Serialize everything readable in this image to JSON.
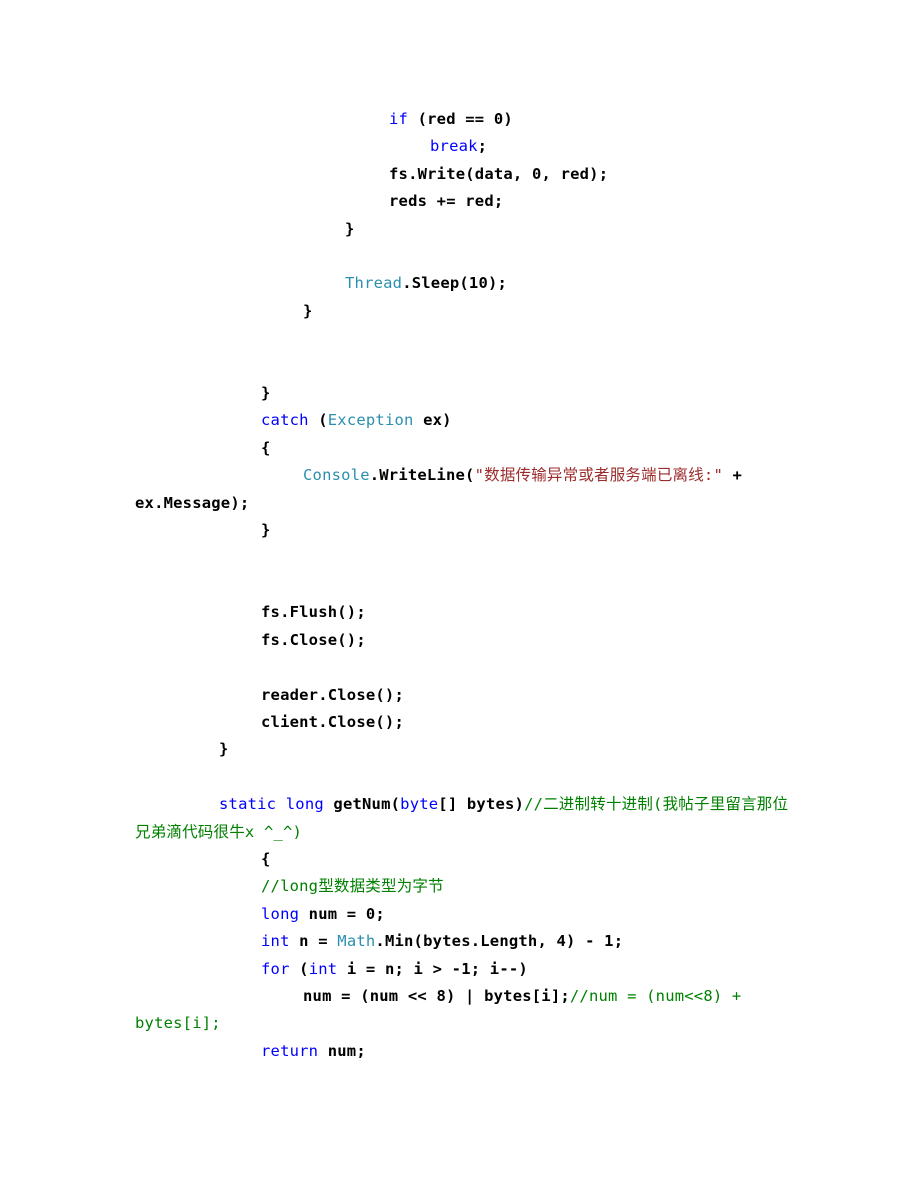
{
  "document": {
    "kind": "code-listing-page",
    "language": "C#",
    "page_background": "#ffffff",
    "colors": {
      "keyword": "#0000FF",
      "type": "#2B8FAE",
      "string": "#9C2C2C",
      "comment": "#008000",
      "plain": "#000000"
    }
  },
  "code": {
    "lines": [
      {
        "id": "line-if-red",
        "indent": 254,
        "tokens": [
          {
            "t": "if",
            "c": "kw"
          },
          {
            "t": " (red == 0)",
            "c": "plain bold"
          }
        ]
      },
      {
        "id": "line-break",
        "indent": 295,
        "tokens": [
          {
            "t": "break",
            "c": "kw"
          },
          {
            "t": ";",
            "c": "plain bold"
          }
        ]
      },
      {
        "id": "line-fs-write",
        "indent": 254,
        "tokens": [
          {
            "t": "fs.Write(data, 0, red);",
            "c": "plain bold"
          }
        ]
      },
      {
        "id": "line-reds-plus",
        "indent": 254,
        "tokens": [
          {
            "t": "reds += red;",
            "c": "plain bold"
          }
        ]
      },
      {
        "id": "line-close-brace-inner",
        "indent": 210,
        "tokens": [
          {
            "t": "}",
            "c": "plain bold"
          }
        ]
      },
      {
        "id": "line-blank-1",
        "indent": 0,
        "tokens": []
      },
      {
        "id": "line-thread-sleep",
        "indent": 210,
        "tokens": [
          {
            "t": "Thread",
            "c": "type"
          },
          {
            "t": ".Sleep(10);",
            "c": "plain bold"
          }
        ]
      },
      {
        "id": "line-close-brace-while",
        "indent": 168,
        "tokens": [
          {
            "t": "}",
            "c": "plain bold"
          }
        ]
      },
      {
        "id": "line-blank-2",
        "indent": 0,
        "tokens": []
      },
      {
        "id": "line-blank-3",
        "indent": 0,
        "tokens": []
      },
      {
        "id": "line-close-brace-try",
        "indent": 126,
        "tokens": [
          {
            "t": "}",
            "c": "plain bold"
          }
        ]
      },
      {
        "id": "line-catch",
        "indent": 126,
        "tokens": [
          {
            "t": "catch",
            "c": "kw"
          },
          {
            "t": " (",
            "c": "plain bold"
          },
          {
            "t": "Exception",
            "c": "type"
          },
          {
            "t": " ex)",
            "c": "plain bold"
          }
        ]
      },
      {
        "id": "line-open-brace-catch",
        "indent": 126,
        "tokens": [
          {
            "t": "{",
            "c": "plain bold"
          }
        ]
      },
      {
        "id": "line-console-writeline",
        "indent": 168,
        "wraps": true,
        "tokens": [
          {
            "t": "Console",
            "c": "type"
          },
          {
            "t": ".WriteLine(",
            "c": "plain bold"
          },
          {
            "t": "\"数据传输异常或者服务端已离线:\"",
            "c": "str"
          },
          {
            "t": " + ex.Message);",
            "c": "plain bold"
          }
        ]
      },
      {
        "id": "line-close-brace-catch",
        "indent": 126,
        "tokens": [
          {
            "t": "}",
            "c": "plain bold"
          }
        ]
      },
      {
        "id": "line-blank-4",
        "indent": 0,
        "tokens": []
      },
      {
        "id": "line-blank-5",
        "indent": 0,
        "tokens": []
      },
      {
        "id": "line-fs-flush",
        "indent": 126,
        "tokens": [
          {
            "t": "fs.Flush();",
            "c": "plain bold"
          }
        ]
      },
      {
        "id": "line-fs-close",
        "indent": 126,
        "tokens": [
          {
            "t": "fs.Close();",
            "c": "plain bold"
          }
        ]
      },
      {
        "id": "line-blank-6",
        "indent": 0,
        "tokens": []
      },
      {
        "id": "line-reader-close",
        "indent": 126,
        "tokens": [
          {
            "t": "reader.Close();",
            "c": "plain bold"
          }
        ]
      },
      {
        "id": "line-client-close",
        "indent": 126,
        "tokens": [
          {
            "t": "client.Close();",
            "c": "plain bold"
          }
        ]
      },
      {
        "id": "line-close-brace-method",
        "indent": 84,
        "tokens": [
          {
            "t": "}",
            "c": "plain bold"
          }
        ]
      },
      {
        "id": "line-blank-7",
        "indent": 0,
        "tokens": []
      },
      {
        "id": "line-getnum-signature",
        "indent": 84,
        "wraps": true,
        "tokens": [
          {
            "t": "static",
            "c": "kw"
          },
          {
            "t": " ",
            "c": "plain"
          },
          {
            "t": "long",
            "c": "kw"
          },
          {
            "t": " getNum(",
            "c": "plain bold"
          },
          {
            "t": "byte",
            "c": "kw"
          },
          {
            "t": "[] bytes)",
            "c": "plain bold"
          },
          {
            "t": "//二进制转十进制(我帖子里留言那位兄弟滴代码很牛x ^_^)",
            "c": "cmt"
          }
        ]
      },
      {
        "id": "line-open-brace-getnum",
        "indent": 126,
        "tokens": [
          {
            "t": "{",
            "c": "plain bold"
          }
        ]
      },
      {
        "id": "line-comment-long-type",
        "indent": 126,
        "tokens": [
          {
            "t": "//long型数据类型为字节",
            "c": "cmt"
          }
        ]
      },
      {
        "id": "line-long-num",
        "indent": 126,
        "tokens": [
          {
            "t": "long",
            "c": "kw"
          },
          {
            "t": " num = 0;",
            "c": "plain bold"
          }
        ]
      },
      {
        "id": "line-int-n",
        "indent": 126,
        "tokens": [
          {
            "t": "int",
            "c": "kw"
          },
          {
            "t": " n = ",
            "c": "plain bold"
          },
          {
            "t": "Math",
            "c": "type"
          },
          {
            "t": ".Min(bytes.Length, 4) - 1;",
            "c": "plain bold"
          }
        ]
      },
      {
        "id": "line-for-loop",
        "indent": 126,
        "tokens": [
          {
            "t": "for",
            "c": "kw"
          },
          {
            "t": " (",
            "c": "plain bold"
          },
          {
            "t": "int",
            "c": "kw"
          },
          {
            "t": " i = n; i > -1; i--)",
            "c": "plain bold"
          }
        ]
      },
      {
        "id": "line-num-shift",
        "indent": 168,
        "wraps": true,
        "tokens": [
          {
            "t": "num = (num << 8) | bytes[i];",
            "c": "plain bold"
          },
          {
            "t": "//num = (num<<8) + bytes[i];",
            "c": "cmt"
          }
        ]
      },
      {
        "id": "line-return-num",
        "indent": 126,
        "tokens": [
          {
            "t": "return",
            "c": "kw"
          },
          {
            "t": " num;",
            "c": "plain bold"
          }
        ]
      }
    ]
  }
}
